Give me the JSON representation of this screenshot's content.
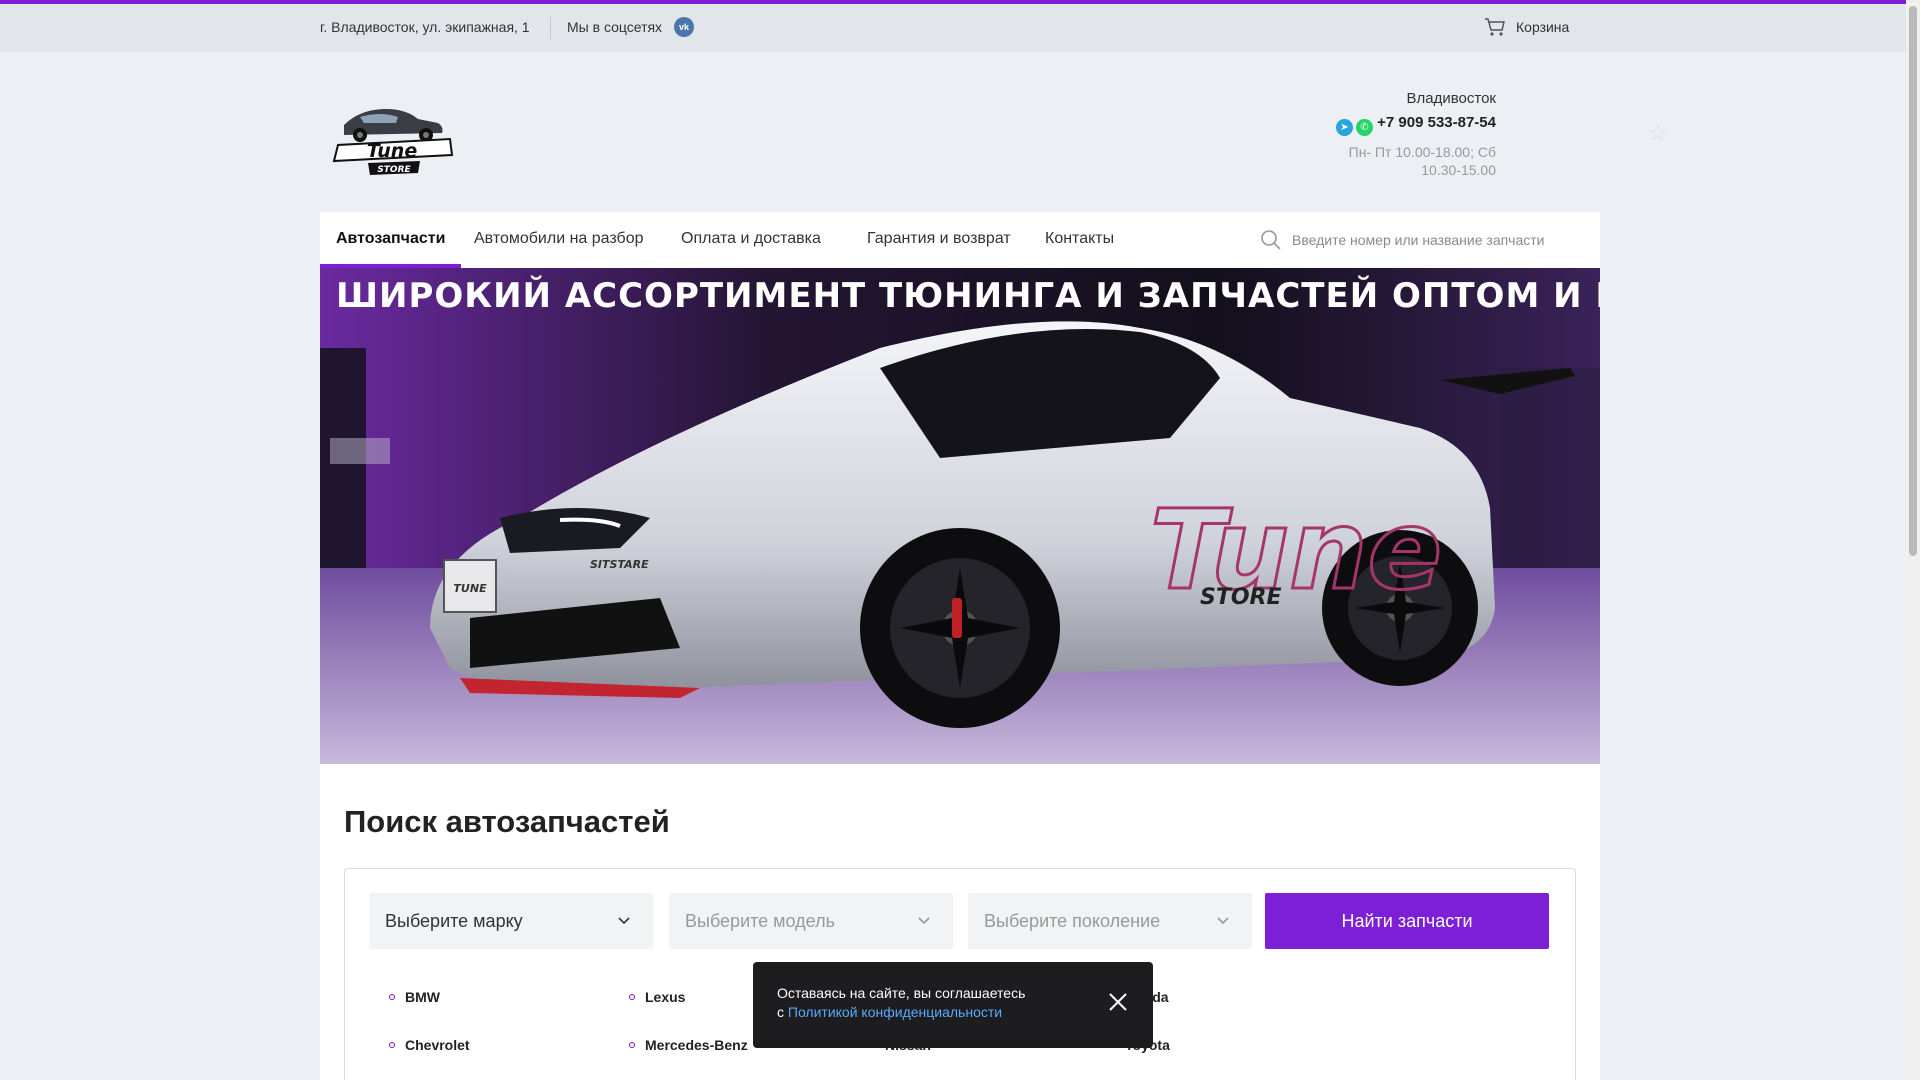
{
  "topbar": {
    "address": "г. Владивосток, ул. экипажная, 1",
    "social_label": "Мы в соцсетях",
    "vk_icon": "vk-icon",
    "cart_label": "Корзина"
  },
  "logo": {
    "line1": "Tune",
    "line2": "STORE"
  },
  "contacts": {
    "city": "Владивосток",
    "phone": "+7 909 533-87-54",
    "hours": "Пн- Пт 10.00-18.00; Сб 10.30-15.00"
  },
  "nav": {
    "items": [
      {
        "label": "Автозапчасти"
      },
      {
        "label": "Автомобили на разбор"
      },
      {
        "label": "Оплата и доставка"
      },
      {
        "label": "Гарантия и возврат"
      },
      {
        "label": "Контакты"
      }
    ],
    "search_placeholder": "Введите номер или название запчасти"
  },
  "banner": {
    "title": "ШИРОКИЙ АССОРТИМЕНТ ТЮНИНГА И ЗАПЧАСТЕЙ  ОПТОМ И В РОЗНИЦУ",
    "door_text": "Tune",
    "door_sub": "STORE",
    "plate": "TUNE",
    "badge": "SITSTARE"
  },
  "parts_search": {
    "title": "Поиск автозапчастей",
    "brand_select": "Выберите марку",
    "model_select": "Выберите модель",
    "generation_select": "Выберите поколение",
    "find_button": "Найти запчасти",
    "brands": [
      "BMW",
      "Lexus",
      "Honda",
      "Chevrolet",
      "Mercedes-Benz",
      "Nissan",
      "Toyota"
    ]
  },
  "cookie": {
    "text": "Оставаясь на сайте, вы соглашаетесь",
    "prefix": "с",
    "link": "Политикой конфиденциальности"
  },
  "colors": {
    "accent": "#7d1fd6",
    "topbar_bg": "#e2e5ea",
    "page_bg": "#eceff3"
  }
}
